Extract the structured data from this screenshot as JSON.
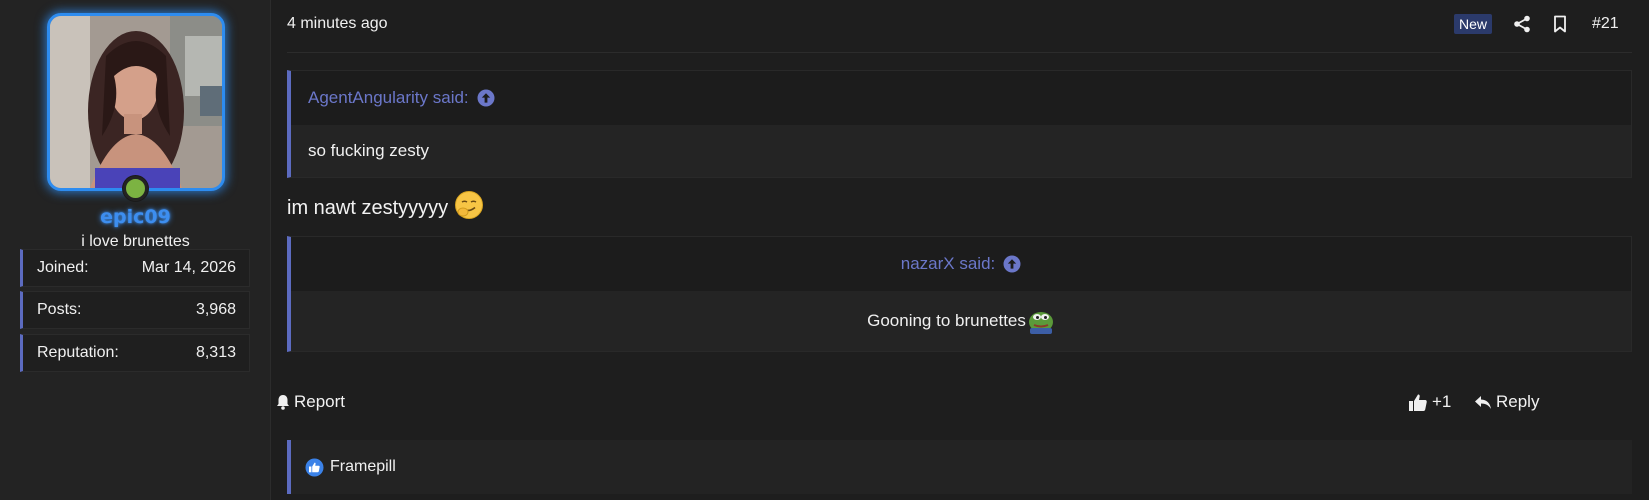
{
  "user": {
    "username": "epic09",
    "title": "i love brunettes",
    "stats": [
      {
        "label": "Joined:",
        "value": "Mar 14, 2026"
      },
      {
        "label": "Posts:",
        "value": "3,968"
      },
      {
        "label": "Reputation:",
        "value": "8,313"
      }
    ],
    "status_color": "#7cb342",
    "username_color": "#3d8ef0"
  },
  "post": {
    "timestamp": "4 minutes ago",
    "new_badge": "New",
    "number": "#21",
    "icons": [
      "share-icon",
      "bookmark-icon"
    ],
    "quotes": [
      {
        "author": "AgentAngularity said:",
        "text": "so fucking zesty"
      },
      {
        "author": "nazarX said:",
        "text": "Gooning to brunettes"
      }
    ],
    "text": "im nawt zestyyyyy",
    "report_label": "Report",
    "like_count": "+1",
    "reply_label": "Reply",
    "reactions": {
      "user": "Framepill"
    }
  },
  "colors": {
    "accent": "#5c6bc0",
    "quote_author": "#6b77c9",
    "background": "#1e1e1e"
  }
}
